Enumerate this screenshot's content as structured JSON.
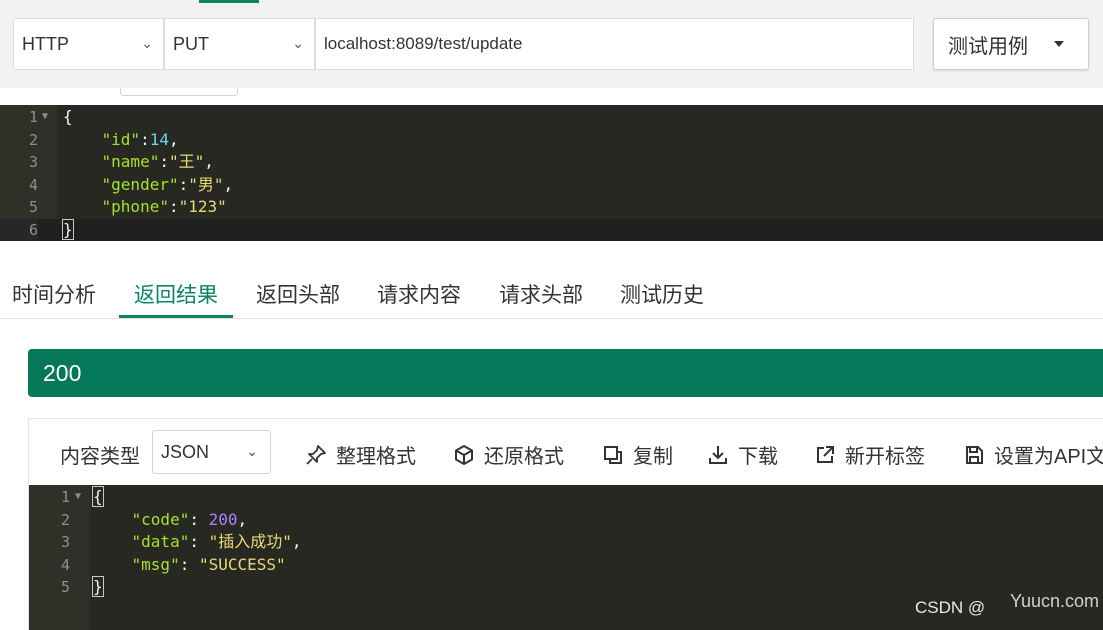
{
  "request": {
    "protocol": "HTTP",
    "method": "PUT",
    "url": "localhost:8089/test/update",
    "test_case_label": "测试用例"
  },
  "request_body_lines": [
    {
      "num": "1",
      "text": "{"
    },
    {
      "num": "2",
      "key": "\"id\"",
      "sep": ":",
      "value": "14",
      "tail": ","
    },
    {
      "num": "3",
      "key": "\"name\"",
      "sep": ":",
      "value": "\"王\"",
      "tail": ","
    },
    {
      "num": "4",
      "key": "\"gender\"",
      "sep": ":",
      "value": "\"男\"",
      "tail": ","
    },
    {
      "num": "5",
      "key": "\"phone\"",
      "sep": ":",
      "value": "\"123\"",
      "tail": ""
    },
    {
      "num": "6",
      "text": "}"
    }
  ],
  "tabs": [
    "时间分析",
    "返回结果",
    "返回头部",
    "请求内容",
    "请求头部",
    "测试历史"
  ],
  "active_tab": "返回结果",
  "status_code": "200",
  "response_toolbar": {
    "content_type_label": "内容类型",
    "content_type_value": "JSON",
    "format": "整理格式",
    "restore": "还原格式",
    "copy": "复制",
    "download": "下载",
    "new_tab": "新开标签",
    "set_api_doc": "设置为API文"
  },
  "response_body_lines": [
    {
      "num": "1",
      "text": "{"
    },
    {
      "num": "2",
      "key": "\"code\"",
      "sep": ": ",
      "value": "200",
      "tail": ","
    },
    {
      "num": "3",
      "key": "\"data\"",
      "sep": ": ",
      "value": "\"插入成功\"",
      "tail": ","
    },
    {
      "num": "4",
      "key": "\"msg\"",
      "sep": ": ",
      "value": "\"SUCCESS\"",
      "tail": ""
    },
    {
      "num": "5",
      "text": "}"
    }
  ],
  "watermark": "CSDN @",
  "watermark_site": "Yuucn.com",
  "colors": {
    "accent_green": "#09855f",
    "status_green": "#06785a",
    "editor_bg": "#272822"
  },
  "icons": {
    "chevron": "chevron-down-icon",
    "caret": "caret-down-icon"
  }
}
